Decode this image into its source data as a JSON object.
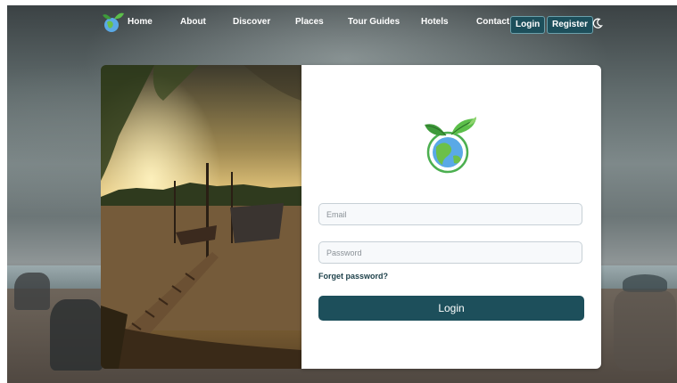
{
  "nav": {
    "links": [
      "Home",
      "About",
      "Discover",
      "Places",
      "Tour Guides",
      "Hotels",
      "Contact"
    ],
    "login_label": "Login",
    "register_label": "Register",
    "theme_icon": "moon-icon"
  },
  "form": {
    "email_placeholder": "Email",
    "password_placeholder": "Password",
    "forget_label": "Forget password?",
    "submit_label": "Login"
  },
  "colors": {
    "primary": "#1d4f5b",
    "logo_green": "#4caf50",
    "logo_blue": "#5aa9e6"
  },
  "icons": {
    "brand": "globe-leaf-icon"
  }
}
